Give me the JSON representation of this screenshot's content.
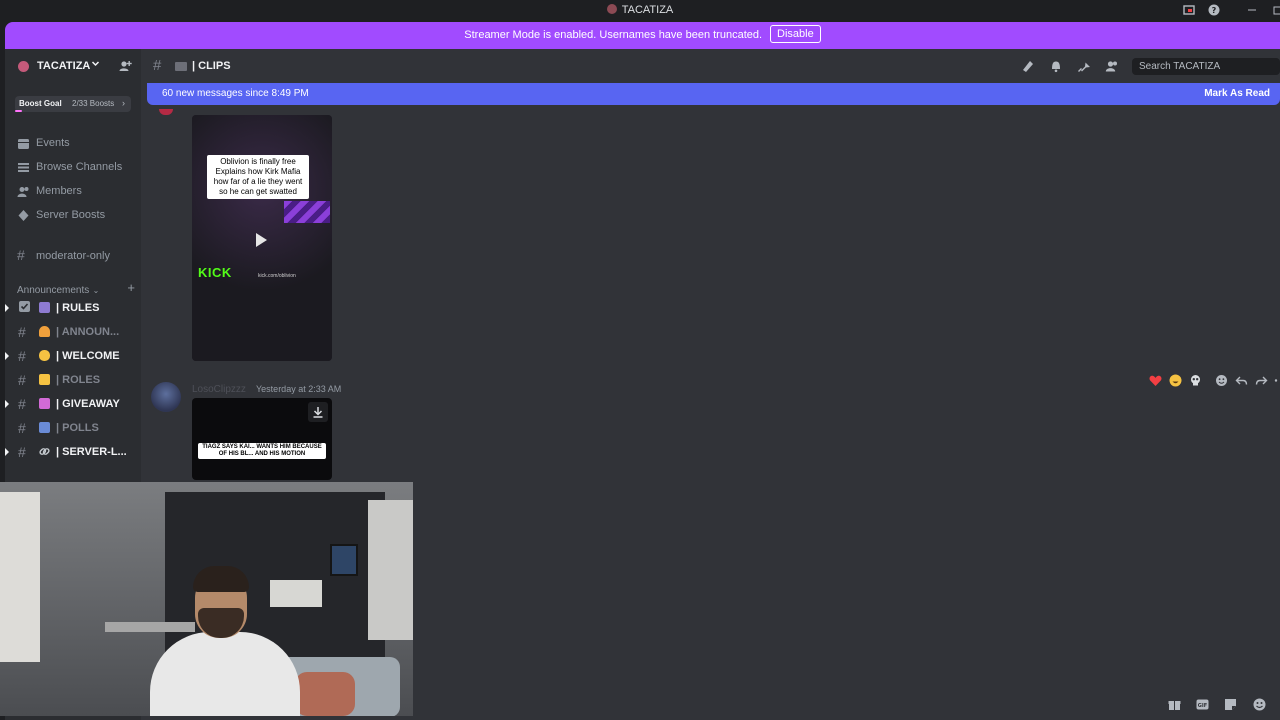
{
  "window": {
    "title": "TACATIZA"
  },
  "banner": {
    "message": "Streamer Mode is enabled. Usernames have been truncated.",
    "button": "Disable"
  },
  "server": {
    "name": "TACATIZA",
    "boost_goal": {
      "label": "Boost Goal",
      "count": "2/33 Boosts",
      "progress": 0.06
    }
  },
  "sidebar": {
    "nav": [
      {
        "label": "Events",
        "icon": "calendar-icon"
      },
      {
        "label": "Browse Channels",
        "icon": "list-icon"
      },
      {
        "label": "Members",
        "icon": "members-icon"
      },
      {
        "label": "Server Boosts",
        "icon": "boost-icon"
      }
    ],
    "moderator_channel": "moderator-only",
    "category": "Announcements",
    "channels": [
      {
        "label": "| RULES",
        "unread": true,
        "emoji_color": "#8e7bd1"
      },
      {
        "label": "| ANNOUN...",
        "unread": false,
        "emoji_color": "#f0a03c"
      },
      {
        "label": "| WELCOME",
        "unread": true,
        "emoji_color": "#f5c242"
      },
      {
        "label": "| ROLES",
        "unread": false,
        "emoji_color": "#f5c242"
      },
      {
        "label": "| GIVEAWAY",
        "unread": true,
        "emoji_color": "#d26ad6"
      },
      {
        "label": "| POLLS",
        "unread": false,
        "emoji_color": "#6a8bd6"
      },
      {
        "label": "| SERVER-L...",
        "unread": true,
        "emoji_color": "#c4c9ce"
      }
    ]
  },
  "channel_header": {
    "name": "| CLIPS",
    "search_placeholder": "Search TACATIZA"
  },
  "new_messages": {
    "text": "60 new messages since 8:49 PM",
    "action": "Mark As Read"
  },
  "messages": [
    {
      "media": {
        "caption": "Oblivion is finally free Explains how Kirk Mafia how far of a lie they went so he can get swatted",
        "brand": "KICK",
        "url_text": "kick.com/oblivion"
      }
    },
    {
      "author": "LosoClipzzz",
      "time": "Yesterday at 2:33 AM",
      "media": {
        "caption": "TIAGZ SAYS KAI... WANTS HIM BECAUSE OF HIS BL... AND HIS MOTION"
      }
    }
  ],
  "colors": {
    "banner": "#a14bff",
    "new_bar": "#5865f2",
    "kick": "#53fc18"
  }
}
